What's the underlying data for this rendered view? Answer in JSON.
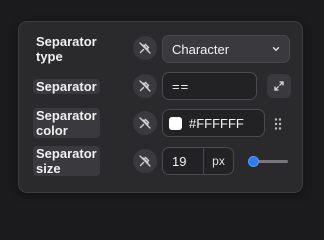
{
  "colors": {
    "accent": "#2f7bf0",
    "panel_bg": "#2a2a2d",
    "page_bg": "#1b1b1d",
    "swatch": "#FFFFFF"
  },
  "rows": {
    "separator_type": {
      "label_line1": "Separator",
      "label_line2": "type",
      "plug_icon": "unlink-plug-icon",
      "value": "Character",
      "dropdown_icon": "chevron-down-icon"
    },
    "separator": {
      "label": "Separator",
      "plug_icon": "unlink-plug-icon",
      "value": "==",
      "expand_icon": "expand-icon"
    },
    "separator_color": {
      "label_line1": "Separator",
      "label_line2": "color",
      "plug_icon": "unlink-plug-icon",
      "value": "#FFFFFF",
      "drag_icon": "drag-handle-icon"
    },
    "separator_size": {
      "label_line1": "Separator",
      "label_line2": "size",
      "plug_icon": "unlink-plug-icon",
      "value": "19",
      "unit": "px",
      "slider_fraction": 0.08
    }
  }
}
